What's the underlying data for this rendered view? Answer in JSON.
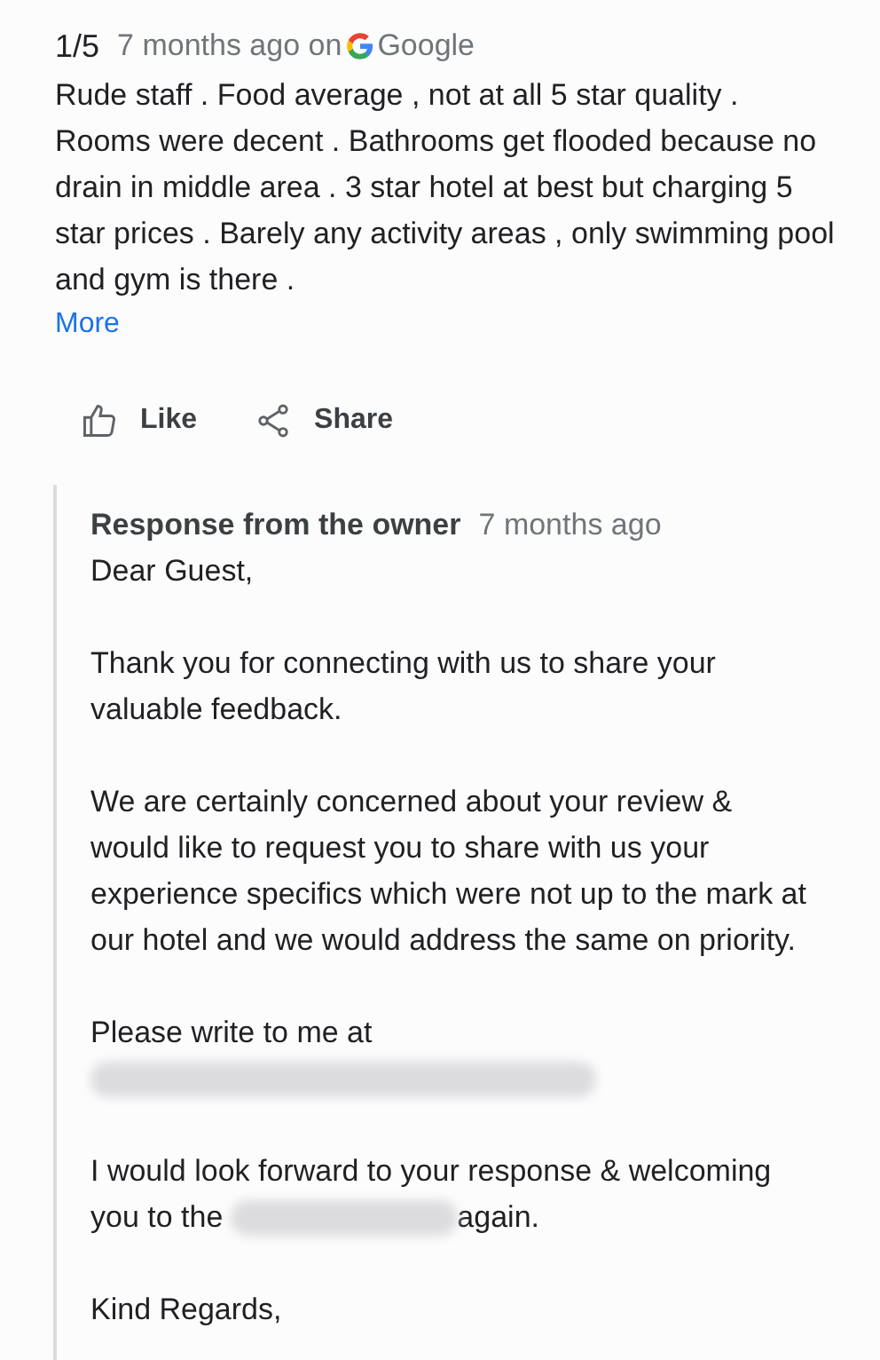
{
  "review": {
    "rating": "1/5",
    "time": "7 months ago on",
    "source": "Google",
    "text": "Rude staff . Food average , not at all 5 star quality . Rooms were decent . Bathrooms get flooded because no drain in middle area . 3 star hotel at best but charging 5 star prices . Barely any activity areas , only swimming pool and gym is there .",
    "more": "More"
  },
  "actions": [
    {
      "kind": "like",
      "label": "Like"
    },
    {
      "kind": "share",
      "label": "Share"
    }
  ],
  "response": {
    "title": "Response from the owner",
    "time": "7 months ago",
    "paragraphs": [
      {
        "kind": "text",
        "text": "Dear Guest,"
      },
      {
        "kind": "text",
        "text": "Thank you for connecting with us to share your valuable feedback."
      },
      {
        "kind": "text",
        "text": "We are certainly concerned about your review & would like to request you to share with us your experience specifics which were not up to the mark at our hotel and we would address the same on priority."
      },
      {
        "kind": "redacted_after",
        "text": "Please write to me at"
      },
      {
        "kind": "redacted_inline",
        "line": "I would look forward to your response & welcoming",
        "before": "you to the",
        "after": "again."
      },
      {
        "kind": "text",
        "text": "Kind Regards,"
      }
    ]
  }
}
